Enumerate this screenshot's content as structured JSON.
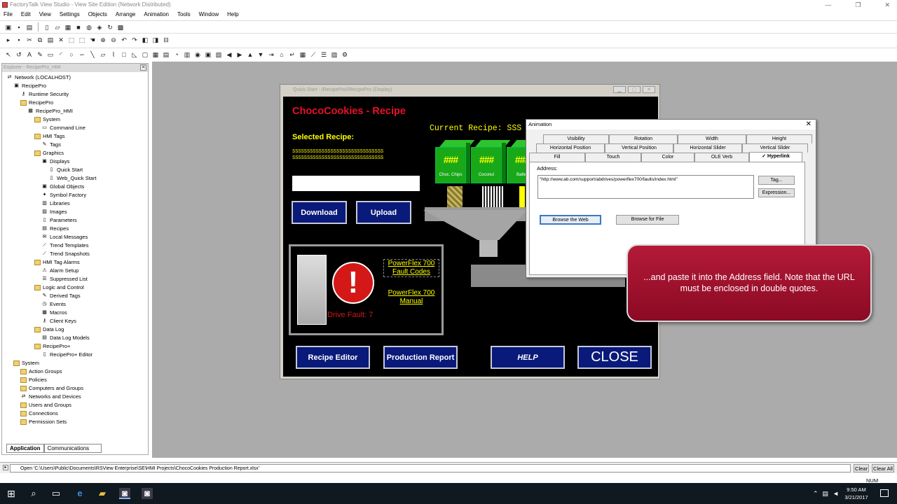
{
  "title": "FactoryTalk View Studio - View Site Edition (Network Distributed)",
  "menu": [
    "File",
    "Edit",
    "View",
    "Settings",
    "Objects",
    "Arrange",
    "Animation",
    "Tools",
    "Window",
    "Help"
  ],
  "explorer": {
    "title": "Explorer - RecipePro_HMI",
    "items": [
      {
        "label": "Network (LOCALHOST)",
        "indent": 0,
        "icon": "network-icon"
      },
      {
        "label": "RecipePro",
        "indent": 1,
        "icon": "application-icon"
      },
      {
        "label": "Runtime Security",
        "indent": 2,
        "icon": "key-icon"
      },
      {
        "label": "RecipePro",
        "indent": 2,
        "icon": "folder-icon"
      },
      {
        "label": "RecipePro_HMI",
        "indent": 3,
        "icon": "hmi-server-icon"
      },
      {
        "label": "System",
        "indent": 4,
        "icon": "folder-icon"
      },
      {
        "label": "Command Line",
        "indent": 5,
        "icon": "command-icon"
      },
      {
        "label": "HMI Tags",
        "indent": 4,
        "icon": "folder-icon"
      },
      {
        "label": "Tags",
        "indent": 5,
        "icon": "tag-icon"
      },
      {
        "label": "Graphics",
        "indent": 4,
        "icon": "folder-icon"
      },
      {
        "label": "Displays",
        "indent": 5,
        "icon": "display-icon"
      },
      {
        "label": "Quick Start",
        "indent": 6,
        "icon": "page-icon"
      },
      {
        "label": "Web_Quick Start",
        "indent": 6,
        "icon": "page-icon"
      },
      {
        "label": "Global Objects",
        "indent": 5,
        "icon": "display-icon"
      },
      {
        "label": "Symbol Factory",
        "indent": 5,
        "icon": "symbol-icon"
      },
      {
        "label": "Libraries",
        "indent": 5,
        "icon": "library-icon"
      },
      {
        "label": "Images",
        "indent": 5,
        "icon": "image-icon"
      },
      {
        "label": "Parameters",
        "indent": 5,
        "icon": "page-icon"
      },
      {
        "label": "Recipes",
        "indent": 5,
        "icon": "recipe-icon"
      },
      {
        "label": "Local Messages",
        "indent": 5,
        "icon": "message-icon"
      },
      {
        "label": "Trend Templates",
        "indent": 5,
        "icon": "trend-icon"
      },
      {
        "label": "Trend Snapshots",
        "indent": 5,
        "icon": "trend-icon"
      },
      {
        "label": "HMI Tag Alarms",
        "indent": 4,
        "icon": "folder-icon"
      },
      {
        "label": "Alarm Setup",
        "indent": 5,
        "icon": "alarm-icon"
      },
      {
        "label": "Suppressed List",
        "indent": 5,
        "icon": "list-icon"
      },
      {
        "label": "Logic and Control",
        "indent": 4,
        "icon": "folder-icon"
      },
      {
        "label": "Derived Tags",
        "indent": 5,
        "icon": "tag-icon"
      },
      {
        "label": "Events",
        "indent": 5,
        "icon": "event-icon"
      },
      {
        "label": "Macros",
        "indent": 5,
        "icon": "macro-icon"
      },
      {
        "label": "Client Keys",
        "indent": 5,
        "icon": "key-icon"
      },
      {
        "label": "Data Log",
        "indent": 4,
        "icon": "folder-icon"
      },
      {
        "label": "Data Log Models",
        "indent": 5,
        "icon": "datalog-icon"
      },
      {
        "label": "RecipePro+",
        "indent": 4,
        "icon": "folder-icon"
      },
      {
        "label": "RecipePro+ Editor",
        "indent": 5,
        "icon": "page-icon"
      },
      {
        "label": "System",
        "indent": 1,
        "icon": "folder-icon"
      },
      {
        "label": "Action Groups",
        "indent": 2,
        "icon": "folder-icon"
      },
      {
        "label": "Policies",
        "indent": 2,
        "icon": "folder-icon"
      },
      {
        "label": "Computers and Groups",
        "indent": 2,
        "icon": "folder-icon"
      },
      {
        "label": "Networks and Devices",
        "indent": 2,
        "icon": "network-icon"
      },
      {
        "label": "Users and Groups",
        "indent": 2,
        "icon": "folder-icon"
      },
      {
        "label": "Connections",
        "indent": 2,
        "icon": "folder-icon"
      },
      {
        "label": "Permission Sets",
        "indent": 2,
        "icon": "folder-icon"
      }
    ],
    "tabs": [
      "Application",
      "Communications"
    ]
  },
  "display": {
    "title": "Quick Start - /RecipePro//RecipePro (Display)",
    "heading": "ChocoCookies - Recipe",
    "selected_recipe": "Selected Recipe:",
    "current_recipe": "Current Recipe: SSS",
    "sss_line": "SSSSSSSSSSSSSSSSSSSSSSSSSSSSSSS",
    "download": "Download",
    "upload": "Upload",
    "chutes": [
      {
        "hash": "###",
        "label": "Choc. Chips"
      },
      {
        "hash": "###",
        "label": "Coconut"
      },
      {
        "hash": "###",
        "label": "Batter"
      }
    ],
    "pf_link": "PowerFlex 700 Fault Codes",
    "pf_manual": "PowerFlex 700 Manual",
    "drive_fault": "Drive Fault: 7",
    "recipe_editor": "Recipe Editor",
    "production_report": "Production Report",
    "help": "HELP",
    "close": "CLOSE"
  },
  "dialog": {
    "title": "Animation",
    "tabs_row1": [
      "Visibility",
      "Rotation",
      "Width",
      "Height"
    ],
    "tabs_row2": [
      "Horizontal Position",
      "Vertical Position",
      "Horizontal Slider",
      "Vertical Slider"
    ],
    "tabs_row3": [
      "Fill",
      "Touch",
      "Color",
      "OLE Verb",
      "✓ Hyperlink"
    ],
    "address_label": "Address:",
    "address_value": "\"http://www.ab.com/support/abdrives/powerflex700/faults/index.html\"",
    "tag_btn": "Tag...",
    "expression_btn": "Expression...",
    "browse_web": "Browse the Web",
    "browse_file": "Browse for File"
  },
  "callout": "...and paste it into the Address field. Note that the URL must be enclosed in double quotes.",
  "status": {
    "message": "Open 'C:\\Users\\Public\\Documents\\RSView Enterprise\\SE\\HMI Projects\\ChocoCookies Production Report.xlsx'",
    "clear": "Clear",
    "clear_all": "Clear All",
    "num": "NUM"
  },
  "taskbar": {
    "time": "9:50 AM",
    "date": "3/21/2017"
  }
}
